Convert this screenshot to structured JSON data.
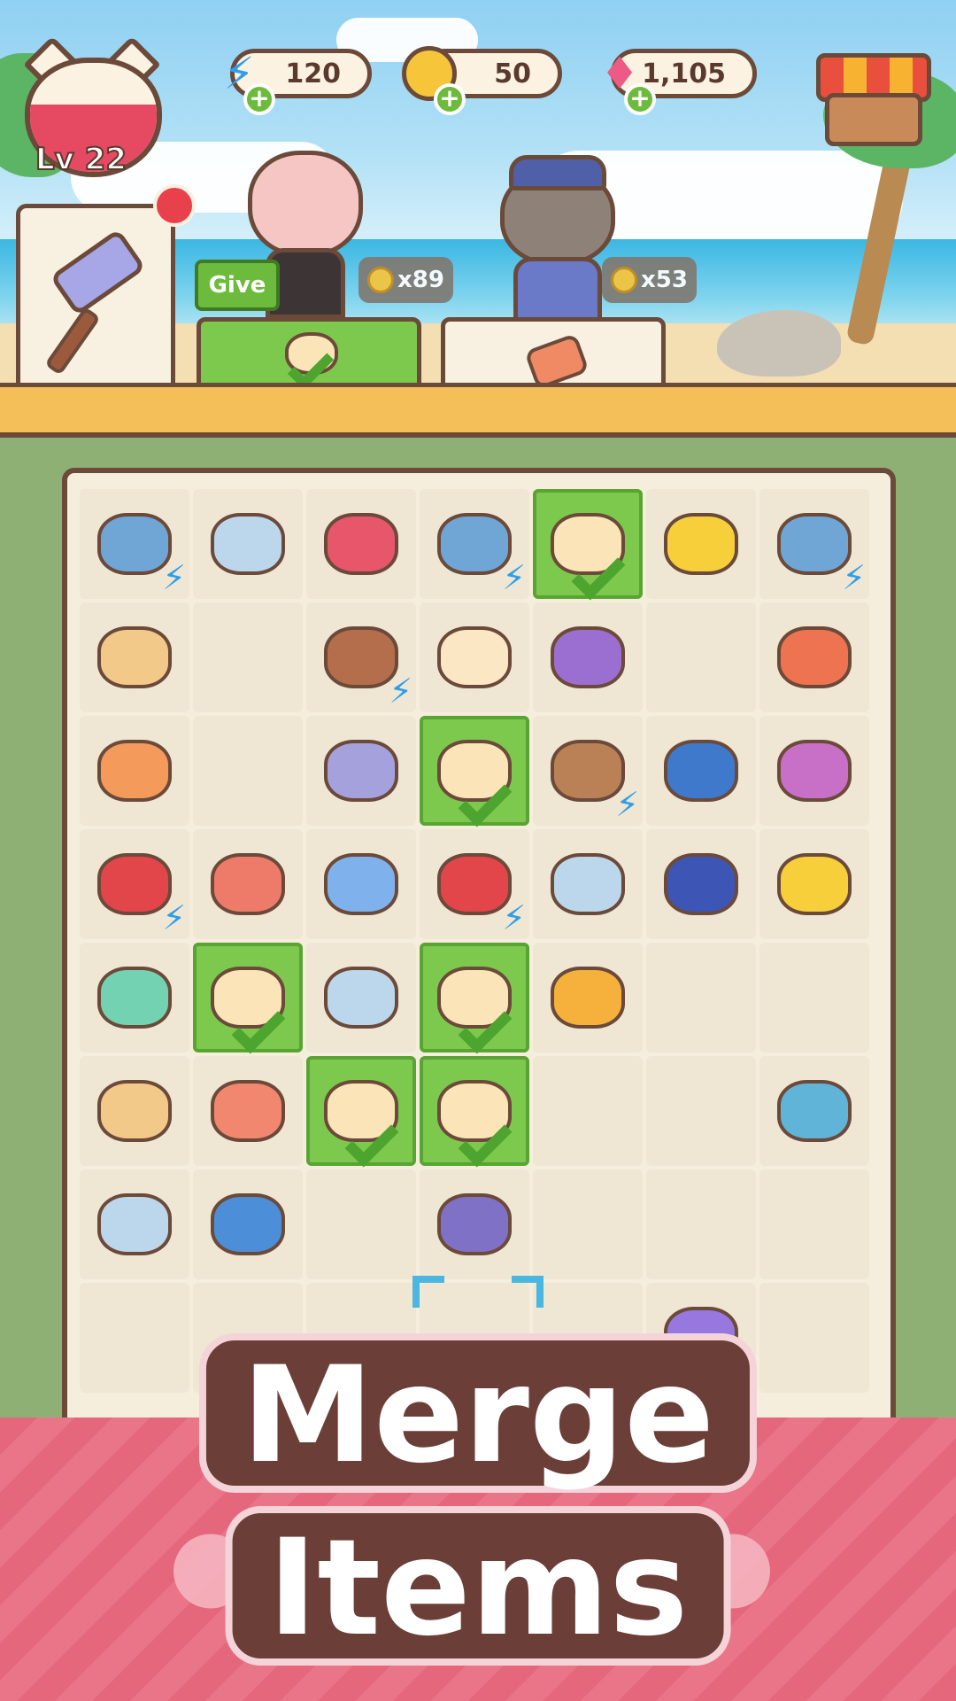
{
  "hud": {
    "level_label": "Lv 22",
    "energy": "120",
    "coins": "50",
    "gems": "1,105",
    "plus_symbol": "+",
    "energy_fill_fraction": 0.62
  },
  "customers": [
    {
      "name": "maid-cat",
      "reward": "x89",
      "give_label": "Give",
      "order_done": true
    },
    {
      "name": "police-cat",
      "reward": "x53",
      "order_done": false
    }
  ],
  "board": {
    "rows": 8,
    "cols": 7,
    "cells": [
      [
        "net-bolt",
        "stones",
        "coral-red",
        "net-bolt",
        "shell-done",
        "coral-yellow",
        "net-basket-bolt"
      ],
      [
        "scallop",
        "",
        "pot-bolt",
        "conch",
        "coral-purple",
        "",
        "snail-red"
      ],
      [
        "coral-orange",
        "",
        "snail-purple",
        "shell-done",
        "basket-bolt",
        "conch-blue",
        "coral-pink"
      ],
      [
        "chest-bolt",
        "shells-red",
        "coral-blue",
        "cart-bolt",
        "stones",
        "coral-navy",
        "coral-yellow"
      ],
      [
        "coral-green",
        "shell-done",
        "stones",
        "shell-done",
        "coral-pearl",
        "",
        ""
      ],
      [
        "scallop",
        "shell-salmon",
        "shell-done",
        "shell-done",
        "",
        "",
        "shell-blue"
      ],
      [
        "stones",
        "coral-blue2",
        "",
        "conch-plate",
        "",
        "",
        ""
      ],
      [
        "",
        "",
        "",
        "",
        "",
        "coral-violet",
        ""
      ]
    ]
  },
  "banner": {
    "line1": "Merge",
    "line2": "Items"
  },
  "colors": {
    "accent_green": "#7cc94e",
    "board_bg": "#f6eedd",
    "banner_pink": "#e4677c",
    "outline": "#6b4a3a"
  }
}
